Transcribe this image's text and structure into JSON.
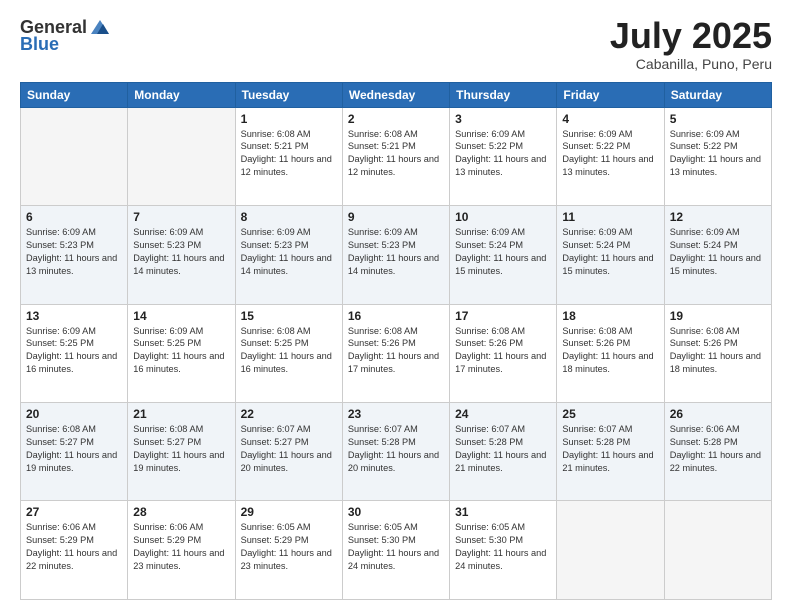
{
  "header": {
    "logo": {
      "general": "General",
      "blue": "Blue"
    },
    "title": "July 2025",
    "location": "Cabanilla, Puno, Peru"
  },
  "calendar": {
    "days_of_week": [
      "Sunday",
      "Monday",
      "Tuesday",
      "Wednesday",
      "Thursday",
      "Friday",
      "Saturday"
    ],
    "weeks": [
      [
        {
          "day": "",
          "info": ""
        },
        {
          "day": "",
          "info": ""
        },
        {
          "day": "1",
          "info": "Sunrise: 6:08 AM\nSunset: 5:21 PM\nDaylight: 11 hours and 12 minutes."
        },
        {
          "day": "2",
          "info": "Sunrise: 6:08 AM\nSunset: 5:21 PM\nDaylight: 11 hours and 12 minutes."
        },
        {
          "day": "3",
          "info": "Sunrise: 6:09 AM\nSunset: 5:22 PM\nDaylight: 11 hours and 13 minutes."
        },
        {
          "day": "4",
          "info": "Sunrise: 6:09 AM\nSunset: 5:22 PM\nDaylight: 11 hours and 13 minutes."
        },
        {
          "day": "5",
          "info": "Sunrise: 6:09 AM\nSunset: 5:22 PM\nDaylight: 11 hours and 13 minutes."
        }
      ],
      [
        {
          "day": "6",
          "info": "Sunrise: 6:09 AM\nSunset: 5:23 PM\nDaylight: 11 hours and 13 minutes."
        },
        {
          "day": "7",
          "info": "Sunrise: 6:09 AM\nSunset: 5:23 PM\nDaylight: 11 hours and 14 minutes."
        },
        {
          "day": "8",
          "info": "Sunrise: 6:09 AM\nSunset: 5:23 PM\nDaylight: 11 hours and 14 minutes."
        },
        {
          "day": "9",
          "info": "Sunrise: 6:09 AM\nSunset: 5:23 PM\nDaylight: 11 hours and 14 minutes."
        },
        {
          "day": "10",
          "info": "Sunrise: 6:09 AM\nSunset: 5:24 PM\nDaylight: 11 hours and 15 minutes."
        },
        {
          "day": "11",
          "info": "Sunrise: 6:09 AM\nSunset: 5:24 PM\nDaylight: 11 hours and 15 minutes."
        },
        {
          "day": "12",
          "info": "Sunrise: 6:09 AM\nSunset: 5:24 PM\nDaylight: 11 hours and 15 minutes."
        }
      ],
      [
        {
          "day": "13",
          "info": "Sunrise: 6:09 AM\nSunset: 5:25 PM\nDaylight: 11 hours and 16 minutes."
        },
        {
          "day": "14",
          "info": "Sunrise: 6:09 AM\nSunset: 5:25 PM\nDaylight: 11 hours and 16 minutes."
        },
        {
          "day": "15",
          "info": "Sunrise: 6:08 AM\nSunset: 5:25 PM\nDaylight: 11 hours and 16 minutes."
        },
        {
          "day": "16",
          "info": "Sunrise: 6:08 AM\nSunset: 5:26 PM\nDaylight: 11 hours and 17 minutes."
        },
        {
          "day": "17",
          "info": "Sunrise: 6:08 AM\nSunset: 5:26 PM\nDaylight: 11 hours and 17 minutes."
        },
        {
          "day": "18",
          "info": "Sunrise: 6:08 AM\nSunset: 5:26 PM\nDaylight: 11 hours and 18 minutes."
        },
        {
          "day": "19",
          "info": "Sunrise: 6:08 AM\nSunset: 5:26 PM\nDaylight: 11 hours and 18 minutes."
        }
      ],
      [
        {
          "day": "20",
          "info": "Sunrise: 6:08 AM\nSunset: 5:27 PM\nDaylight: 11 hours and 19 minutes."
        },
        {
          "day": "21",
          "info": "Sunrise: 6:08 AM\nSunset: 5:27 PM\nDaylight: 11 hours and 19 minutes."
        },
        {
          "day": "22",
          "info": "Sunrise: 6:07 AM\nSunset: 5:27 PM\nDaylight: 11 hours and 20 minutes."
        },
        {
          "day": "23",
          "info": "Sunrise: 6:07 AM\nSunset: 5:28 PM\nDaylight: 11 hours and 20 minutes."
        },
        {
          "day": "24",
          "info": "Sunrise: 6:07 AM\nSunset: 5:28 PM\nDaylight: 11 hours and 21 minutes."
        },
        {
          "day": "25",
          "info": "Sunrise: 6:07 AM\nSunset: 5:28 PM\nDaylight: 11 hours and 21 minutes."
        },
        {
          "day": "26",
          "info": "Sunrise: 6:06 AM\nSunset: 5:28 PM\nDaylight: 11 hours and 22 minutes."
        }
      ],
      [
        {
          "day": "27",
          "info": "Sunrise: 6:06 AM\nSunset: 5:29 PM\nDaylight: 11 hours and 22 minutes."
        },
        {
          "day": "28",
          "info": "Sunrise: 6:06 AM\nSunset: 5:29 PM\nDaylight: 11 hours and 23 minutes."
        },
        {
          "day": "29",
          "info": "Sunrise: 6:05 AM\nSunset: 5:29 PM\nDaylight: 11 hours and 23 minutes."
        },
        {
          "day": "30",
          "info": "Sunrise: 6:05 AM\nSunset: 5:30 PM\nDaylight: 11 hours and 24 minutes."
        },
        {
          "day": "31",
          "info": "Sunrise: 6:05 AM\nSunset: 5:30 PM\nDaylight: 11 hours and 24 minutes."
        },
        {
          "day": "",
          "info": ""
        },
        {
          "day": "",
          "info": ""
        }
      ]
    ]
  }
}
